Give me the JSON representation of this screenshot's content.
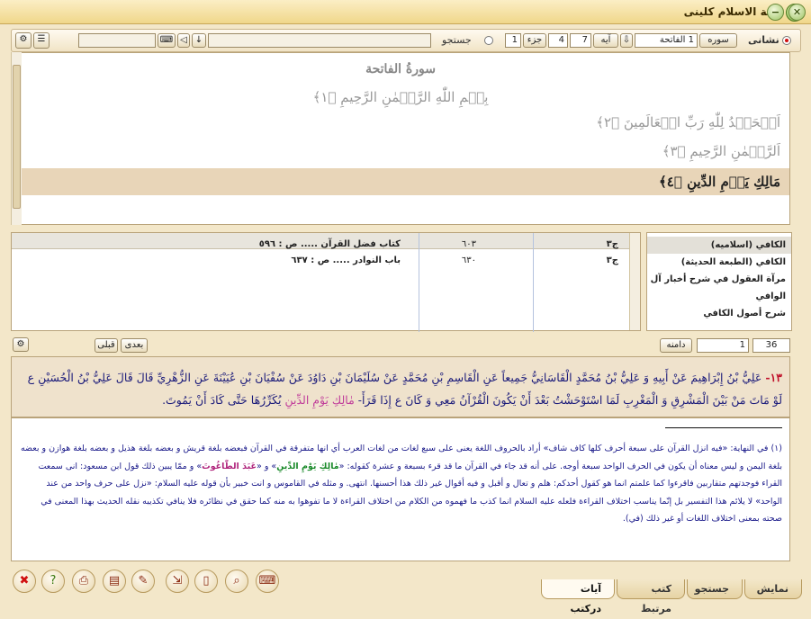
{
  "window": {
    "title": "ثقة الاسلام كلینی"
  },
  "toolbar": {
    "display_label": "نشانی",
    "sura_label": "سوره",
    "sura_value": "1 الفاتحة",
    "ayah_label": "آيه",
    "ayah_value": "7",
    "ayah_cur": "4",
    "juz_label": "جزء",
    "juz_value": "1",
    "search_label": "جستجو"
  },
  "quran": {
    "sura_title": "سورةُ الفاتحة",
    "bismillah": "بِسۡمِ اللّٰهِ الرَّحۡمٰنِ الرَّحِيمِ ﴿١﴾",
    "ayah2": "اَلۡحَمۡدُ لِلّٰهِ رَبِّ الۡعَالَمِينَ ﴿٢﴾",
    "ayah3": "اَلرَّحۡمٰنِ الرَّحِيمِ ﴿٣﴾",
    "ayah4": "مَالِكِ يَوۡمِ الدِّينِ ﴿٤﴾"
  },
  "refs": {
    "rows": [
      {
        "vol": "ج٣",
        "num": "٦٠٣",
        "book": "كتاب فضل القرآن ..... ص : ٥٩٦"
      },
      {
        "vol": "ج٣",
        "num": "٦٣٠",
        "book": "باب النوادر ..... ص : ٦٣٧"
      }
    ]
  },
  "books": [
    "الکافي (اسلامیه)",
    "الکافي (الطبعة الحديثة)",
    "مرآة العقول في شرح أخبار آل ...",
    "الوافي",
    "شرح أصول الكافي"
  ],
  "nav": {
    "next": "بعدی",
    "prev": "قبلی",
    "page_label": "دامنه",
    "page_value": "1",
    "total": "36"
  },
  "hadith": {
    "number": "١٣-",
    "part1": " عَلِيُّ بْنُ إِبْرَاهِيمَ عَنْ أَبِيهِ وَ عَلِيُّ بْنُ مُحَمَّدٍ الْقَاسَانِيُّ جَمِيعاً عَنِ الْقَاسِمِ بْنِ مُحَمَّدٍ عَنْ سُلَيْمَانَ بْنِ دَاوُدَ عَنْ سُفْيَانَ بْنِ عُيَيْنَةَ عَنِ الزُّهْرِيِّ قَالَ قَالَ عَلِيُّ بْنُ الْحُسَيْنِ ع ",
    "part2": "لَوْ مَاتَ مَنْ بَيْنَ الْمَشْرِقِ وَ الْمَغْرِبِ لَمَا اسْتَوْحَشْتُ بَعْدَ أَنْ يَكُونَ الْقُرْآنُ مَعِي وَ كَانَ ع إِذَا قَرَأَ- ",
    "quote": "مٰالِكِ يَوْمِ الدِّينِ",
    "part3": " يُكَرِّرُهَا حَتَّى كَادَ أَنْ يَمُوتَ."
  },
  "footnote": {
    "text1": "(١) في النهاية: «فيه انزل القرآن على سبعة أحرف كلها كاف شاف» أراد بالحروف اللغة يعنى على سبع لغات من لغات العرب أي انها متفرقة في القرآن فبعضه بلغة قريش و بعضه بلغة هذيل و بعضه بلغة هوازن و بعضه بلغة اليمن و ليس معناه أن يكون في الحرف الواحد سبعة أوجه. على أنه قد جاء في القرآن ما قد قرء بسبعة و عشرة كقوله: «",
    "g1": "مٰالِكِ يَوْمِ الدِّينِ",
    "mid": "» و «",
    "p1": "عَبَدَ الطّٰاغُوتَ",
    "text2": "» و ممّا يبين ذلك قول ابن مسعود: انى سمعت القراء فوجدتهم متقاربين فاقرءوا كما علمتم انما هو كقول أحدكم: هلم و تعال و أقبل و فيه أقوال غير ذلك هذا أحسنها. انتهى. و مثله في القاموس و انت خبير بأن قوله عليه السلام: «نزل على حرف واحد من عند الواحد» لا يلائم هذا التفسير بل إنّما يناسب اختلاف القراءة فلعله عليه السلام انما كذب ما فهموه من الكلام من اختلاف القراءة لا ما تفوهوا به منه كما حقق في نظائره فلا ينافي تكذيبه نقله الحديث بهذا المعنى في صحته بمعنى اختلاف اللغات أو غير ذلك (في)."
  },
  "tabs": [
    "نمایش",
    "جستجو",
    "کتب مرتبط",
    "آیات درکتب"
  ]
}
